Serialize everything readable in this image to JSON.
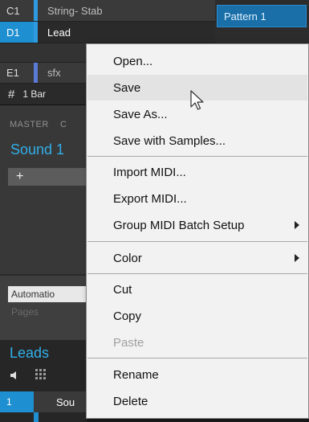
{
  "groups": [
    {
      "code": "C1",
      "name": "String- Stab",
      "strip": "#2e9be0"
    },
    {
      "code": "D1",
      "name": "Lead",
      "strip": "#2e9be0"
    },
    {
      "code": "E1",
      "name": "sfx",
      "strip": "#5a7ad6"
    }
  ],
  "pattern": {
    "label": "Pattern 1"
  },
  "bar": {
    "hash": "#",
    "label": "1 Bar"
  },
  "master": {
    "label": "MASTER",
    "extra": "C",
    "sound_title": "Sound 1",
    "plus": "+"
  },
  "automation": {
    "button": "Automatio",
    "pages": "Pages"
  },
  "leads": {
    "title": "Leads",
    "speaker": "◀",
    "row_num": "1",
    "row_name": "Sou"
  },
  "menu": {
    "items": [
      {
        "label": "Open...",
        "state": "normal"
      },
      {
        "label": "Save",
        "state": "highlighted"
      },
      {
        "label": "Save As...",
        "state": "normal"
      },
      {
        "label": "Save with Samples...",
        "state": "normal"
      },
      {
        "label": "Import MIDI...",
        "state": "normal"
      },
      {
        "label": "Export MIDI...",
        "state": "normal"
      },
      {
        "label": "Group MIDI Batch Setup",
        "state": "normal",
        "submenu": true
      },
      {
        "label": "Color",
        "state": "normal",
        "submenu": true
      },
      {
        "label": "Cut",
        "state": "normal"
      },
      {
        "label": "Copy",
        "state": "normal"
      },
      {
        "label": "Paste",
        "state": "disabled"
      },
      {
        "label": "Rename",
        "state": "normal"
      },
      {
        "label": "Delete",
        "state": "normal"
      }
    ]
  },
  "colors": {
    "accent": "#31aee8",
    "selected": "#1e8fd0",
    "menu_bg": "#f2f2f2"
  }
}
